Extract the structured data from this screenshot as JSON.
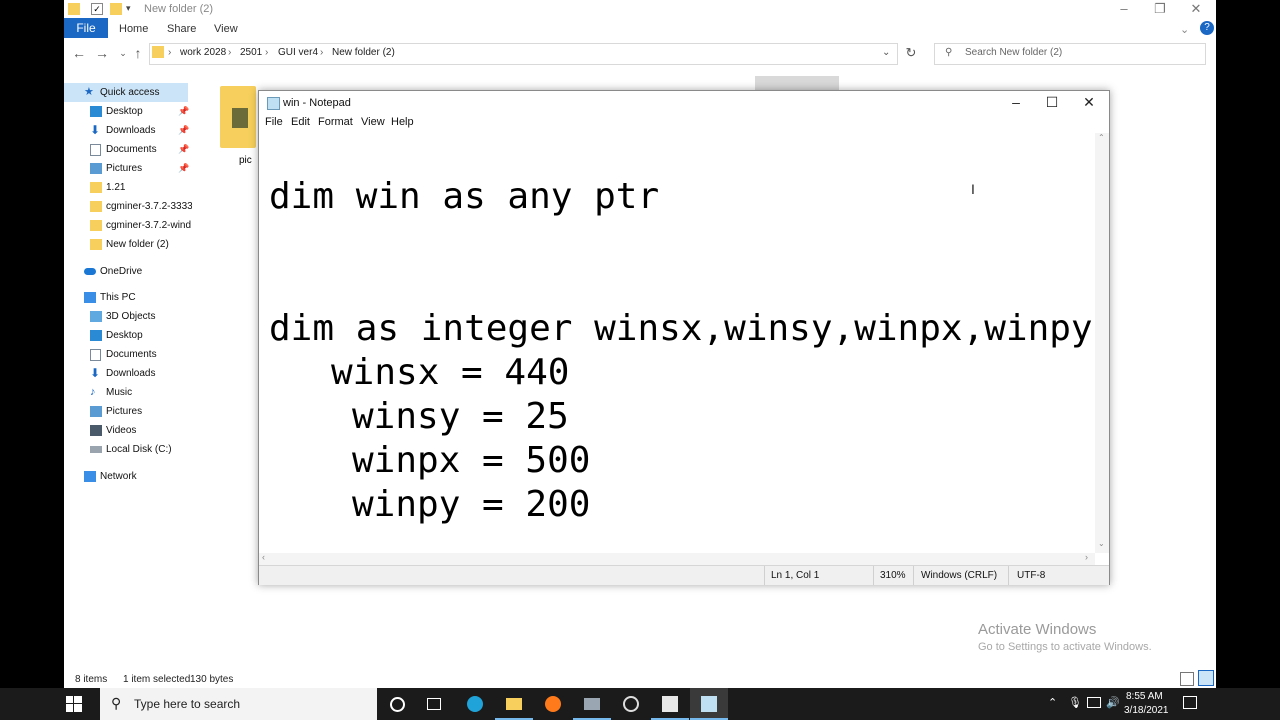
{
  "explorer": {
    "title": "New folder (2)",
    "ribbon": {
      "file": "File",
      "home": "Home",
      "share": "Share",
      "view": "View"
    },
    "breadcrumbs": [
      "work 2028",
      "2501",
      "GUI ver4",
      "New folder (2)"
    ],
    "search_placeholder": "Search New folder (2)",
    "sidebar": {
      "quick_access": "Quick access",
      "quick_items": [
        "Desktop",
        "Downloads",
        "Documents",
        "Pictures",
        "1.21",
        "cgminer-3.7.2-3333",
        "cgminer-3.7.2-wind",
        "New folder (2)"
      ],
      "onedrive": "OneDrive",
      "this_pc": "This PC",
      "pc_items": [
        "3D Objects",
        "Desktop",
        "Documents",
        "Downloads",
        "Music",
        "Pictures",
        "Videos",
        "Local Disk (C:)"
      ],
      "network": "Network"
    },
    "file_label": "pic",
    "status": {
      "items": "8 items",
      "selected": "1 item selected",
      "size": "130 bytes"
    }
  },
  "notepad": {
    "title": "win - Notepad",
    "menu": [
      "File",
      "Edit",
      "Format",
      "View",
      "Help"
    ],
    "lines": [
      "dim win as any ptr",
      "dim as integer winsx,winsy,winpx,winpy",
      "winsx = 440",
      "winsy = 25",
      "winpx = 500",
      "winpy = 200"
    ],
    "status": {
      "position": "Ln 1, Col 1",
      "zoom": "310%",
      "eol": "Windows (CRLF)",
      "encoding": "UTF-8"
    }
  },
  "watermark": {
    "line1": "Activate Windows",
    "line2": "Go to Settings to activate Windows."
  },
  "taskbar": {
    "search_placeholder": "Type here to search",
    "time": "8:55 AM",
    "date": "3/18/2021"
  },
  "colors": {
    "accent": "#1a67c4",
    "taskbar": "#1b1b1b",
    "folder": "#f6cf5c"
  }
}
